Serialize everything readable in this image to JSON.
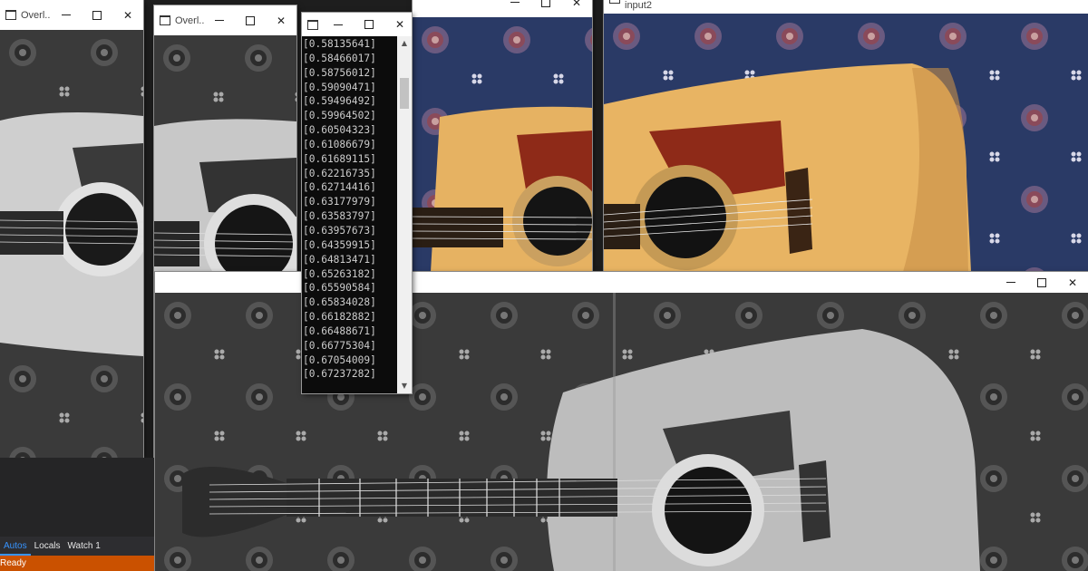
{
  "windows": {
    "overlay1": {
      "title": "Overl..."
    },
    "overlay2": {
      "title": "Overl..."
    },
    "input1": {
      "title": ""
    },
    "input2": {
      "title": "input2"
    },
    "result": {
      "title": ""
    },
    "console": {
      "title": ""
    }
  },
  "console": {
    "lines": [
      "[0.58135641]",
      "[0.58466017]",
      "[0.58756012]",
      "[0.59090471]",
      "[0.59496492]",
      "[0.59964502]",
      "[0.60504323]",
      "[0.61086679]",
      "[0.61689115]",
      "[0.62216735]",
      "[0.62714416]",
      "[0.63177979]",
      "[0.63583797]",
      "[0.63957673]",
      "[0.64359915]",
      "[0.64813471]",
      "[0.65263182]",
      "[0.65590584]",
      "[0.65834028]",
      "[0.66182882]",
      "[0.66488671]",
      "[0.66775304]",
      "[0.67054009]",
      "[0.67237282]"
    ]
  },
  "ide": {
    "tabs": [
      "Autos",
      "Locals",
      "Watch 1"
    ],
    "active_tab": "Autos",
    "status": "Ready"
  },
  "colors": {
    "status_bar": "#ca5100",
    "carpet_blue": "#2a3a66",
    "guitar_top": "#e9b767",
    "pickguard": "#8e2a18"
  }
}
